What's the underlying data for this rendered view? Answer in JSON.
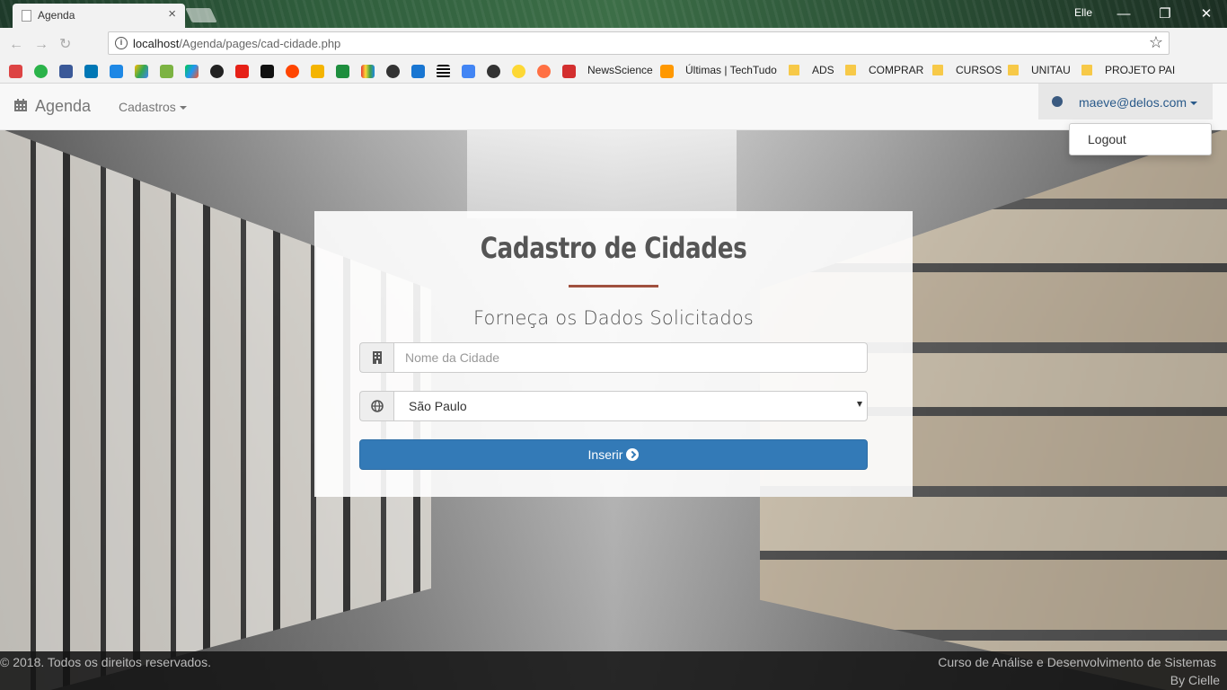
{
  "browser": {
    "tab_title": "Agenda",
    "tab_close": "×",
    "profile_name": "Elle",
    "window_min": "—",
    "window_max": "❐",
    "window_close": "✕",
    "url_host": "localhost",
    "url_path": "/Agenda/pages/cad-cidade.php",
    "info_icon": "i",
    "star_icon": "☆",
    "menu_icon": "⋮",
    "bookmarks": [
      {
        "label": "NewsScience"
      },
      {
        "label": "Últimas | TechTudo"
      },
      {
        "label": "ADS"
      },
      {
        "label": "COMPRAR"
      },
      {
        "label": "CURSOS"
      },
      {
        "label": "UNITAU"
      },
      {
        "label": "PROJETO PAI"
      }
    ]
  },
  "navbar": {
    "brand": "Agenda",
    "cadastros": "Cadastros",
    "user_email": "maeve@delos.com",
    "dropdown_logout": "Logout"
  },
  "form": {
    "title": "Cadastro de Cidades",
    "subtitle": "Forneça os Dados Solicitados",
    "city_placeholder": "Nome da Cidade",
    "state_selected": "São Paulo",
    "submit_label": "Inserir"
  },
  "footer": {
    "copyright": "© 2018. Todos os direitos reservados.",
    "course": "Curso de Análise e Desenvolvimento de Sistemas",
    "by": "By Cielle"
  },
  "colors": {
    "primary": "#337ab7",
    "divider": "#a0513f",
    "navbar_bg": "#f8f8f8"
  }
}
